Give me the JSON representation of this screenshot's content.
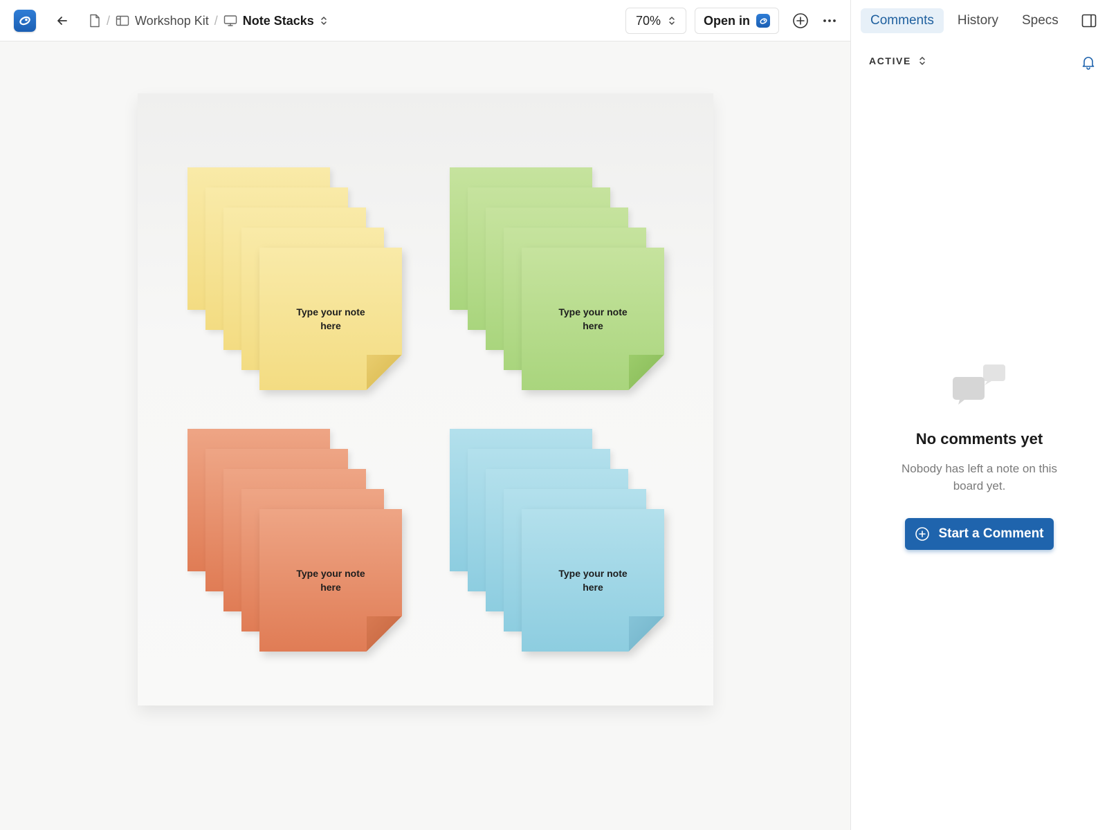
{
  "breadcrumb": {
    "parent_label": "Workshop Kit",
    "current_label": "Note Stacks",
    "separator": "/"
  },
  "toolbar": {
    "zoom_value": "70%",
    "open_in_label": "Open in"
  },
  "board": {
    "stacks": [
      {
        "color": "yellow",
        "accent": "#f3dc82",
        "note_text": "Type your note here"
      },
      {
        "color": "green",
        "accent": "#a9d57d",
        "note_text": "Type your note here"
      },
      {
        "color": "orange",
        "accent": "#e07c55",
        "note_text": "Type your note here"
      },
      {
        "color": "blue",
        "accent": "#8dcde0",
        "note_text": "Type your note here"
      }
    ]
  },
  "panel": {
    "tabs": [
      {
        "label": "Comments",
        "active": true
      },
      {
        "label": "History",
        "active": false
      },
      {
        "label": "Specs",
        "active": false
      }
    ],
    "filter_label": "ACTIVE",
    "empty_title": "No comments yet",
    "empty_description": "Nobody has left a note on this board yet.",
    "start_button_label": "Start a Comment"
  },
  "colors": {
    "brand": "#1f64ad",
    "active_tab_bg": "#e7f0f8",
    "active_tab_text": "#1e5f9e"
  },
  "icons": {
    "app": "app-logo-icon",
    "back": "arrow-left-icon",
    "file": "file-icon",
    "board": "board-icon",
    "frame": "monitor-icon",
    "sort": "chevron-up-down-icon",
    "add": "plus-circle-icon",
    "more": "more-horizontal-icon",
    "panel": "sidebar-toggle-icon",
    "bell": "bell-icon",
    "comments": "chat-bubbles-icon"
  }
}
